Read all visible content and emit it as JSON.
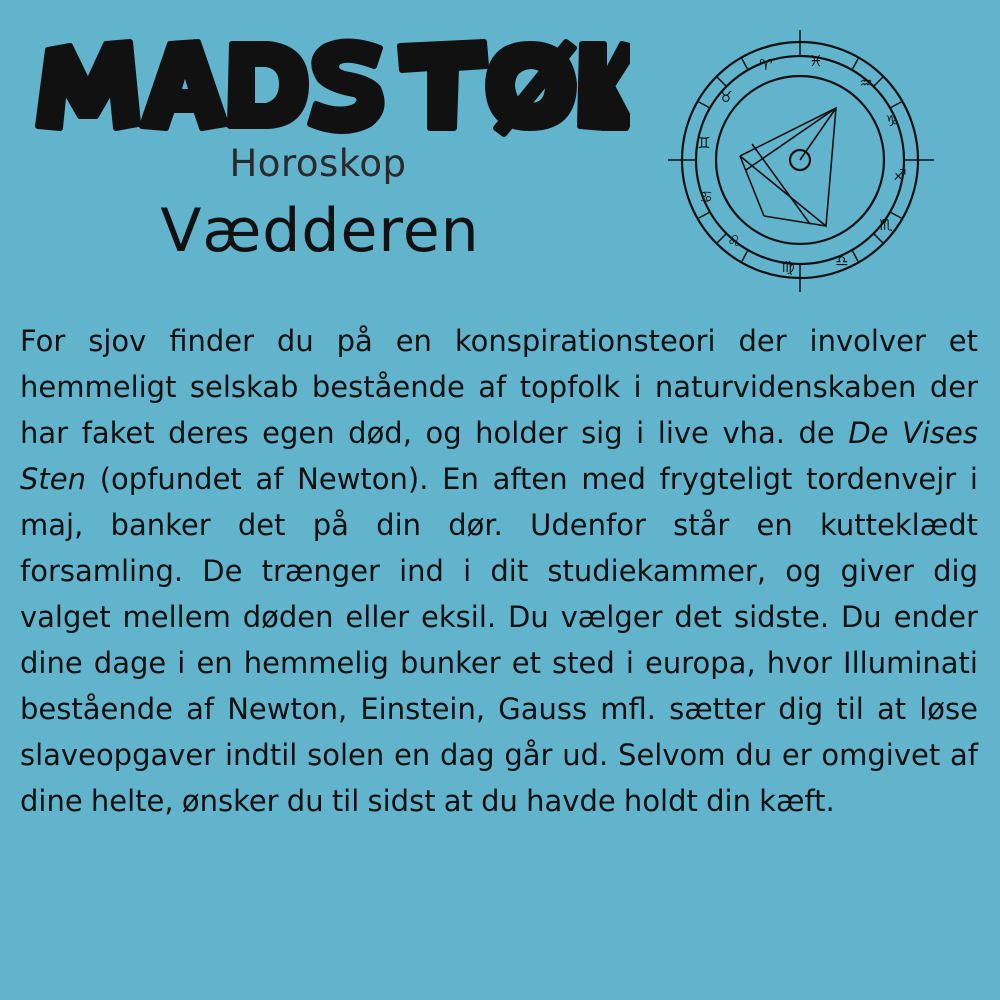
{
  "header": {
    "logo_text": "MADS TØK",
    "subtitle": "Horoskop",
    "sign_name": "Vædderen"
  },
  "icons": {
    "chart": "astrology-chart-icon"
  },
  "colors": {
    "background": "#62b4cd",
    "text": "#111111"
  },
  "body": {
    "part1": "For sjov finder du på en konspirationsteori der involver et hemmeligt selskab bestående af topfolk i naturvidenskaben der har faket deres egen død, og holder sig i live vha. de ",
    "emphasis": "De Vises Sten",
    "part2": " (opfundet af Newton). En aften med frygteligt tordenvejr i maj, banker det på din dør. Udenfor står en kutteklædt forsamling. De trænger ind i dit studiekammer, og giver dig valget mellem døden eller eksil. Du vælger det sidste. Du ender dine dage i en hemmelig bunker et sted i europa, hvor Illuminati bestående af Newton, Einstein, Gauss mfl. sætter dig til at løse slaveopgaver indtil solen en dag går ud. Selvom du er omgivet af dine helte, ønsker du til sidst at du havde holdt din kæft."
  }
}
